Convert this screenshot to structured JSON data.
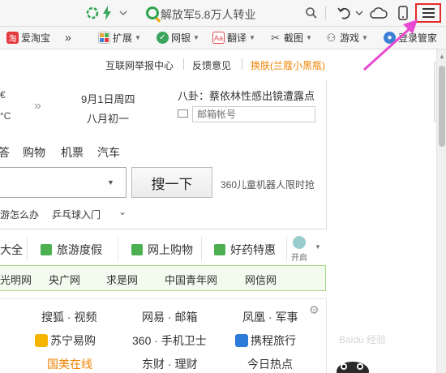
{
  "topbar": {
    "address_text": "解放军5.8万人转业"
  },
  "bookmarks": [
    {
      "label": "爱淘宝",
      "icon": "taobao-icon",
      "color": "#e4393c"
    },
    {
      "label": "»",
      "icon": ""
    },
    {
      "label": "扩展",
      "icon": "extension-icon",
      "color": "#4caf50"
    },
    {
      "label": "网银",
      "icon": "bank-shield-icon",
      "color": "#3aa55d"
    },
    {
      "label": "翻译",
      "icon": "translate-icon",
      "color": "#e05050"
    },
    {
      "label": "截图",
      "icon": "scissors-icon",
      "color": "#555"
    },
    {
      "label": "游戏",
      "icon": "gamepad-icon",
      "color": "#555"
    },
    {
      "label": "登录管家",
      "icon": "user-icon",
      "color": "#3b80d6"
    }
  ],
  "toplinks": {
    "report": "互联网举报中心",
    "feedback": "反馈意见",
    "skin": "换肤(兰蔻小黑瓶)"
  },
  "weather": {
    "temp_top": "€",
    "temp_unit": "°C"
  },
  "date": {
    "solar": "9月1日周四",
    "lunar": "八月初一"
  },
  "gossip": "八卦：蔡依林性感出镜遭露点",
  "mail": {
    "placeholder": "邮箱帐号"
  },
  "search_tabs": [
    "答",
    "购物",
    "机票",
    "汽车"
  ],
  "search": {
    "button": "搜一下",
    "promo": "360儿童机器人限时抢"
  },
  "suggestions": [
    "游怎么办",
    "乒乓球入门"
  ],
  "categories": [
    {
      "label": "大全"
    },
    {
      "label": "旅游度假",
      "icon": "map-icon",
      "color": "#4caf50"
    },
    {
      "label": "网上购物",
      "icon": "cart-icon",
      "color": "#4caf50"
    },
    {
      "label": "好药特惠",
      "icon": "medicine-icon",
      "color": "#4caf50"
    }
  ],
  "kaiqi": "开启",
  "green_links": [
    "光明网",
    "央广网",
    "求是网",
    "中国青年网",
    "网信网"
  ],
  "grid": [
    [
      "搜狐 · 视频",
      "网易 · 邮箱",
      "凤凰 · 军事"
    ],
    [
      "苏宁易购",
      "360 · 手机卫士",
      "携程旅行"
    ],
    [
      "国美在线",
      "东财 · 理财",
      "今日热点"
    ]
  ],
  "grid_icons": {
    "suning": "#f5b400",
    "ctrip": "#2d7bd8"
  },
  "watermark": "Baidu 经验",
  "colors": {
    "accent_green": "#2ea44f",
    "skin_link": "#f08200",
    "menu_highlight": "#e62a2a",
    "arrow": "#e84bd0"
  }
}
